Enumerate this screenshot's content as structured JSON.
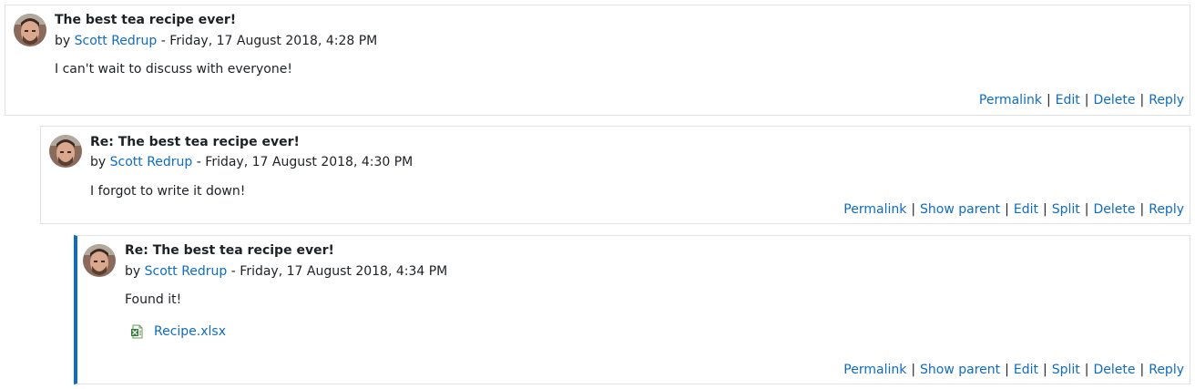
{
  "posts": [
    {
      "subject": "The best tea recipe ever!",
      "by_prefix": "by",
      "author": "Scott Redrup",
      "date": " - Friday, 17 August 2018, 4:28 PM",
      "content": "I can't wait to discuss with everyone!",
      "commands": [
        "Permalink",
        "Edit",
        "Delete",
        "Reply"
      ]
    },
    {
      "subject": "Re: The best tea recipe ever!",
      "by_prefix": "by",
      "author": "Scott Redrup",
      "date": " - Friday, 17 August 2018, 4:30 PM",
      "content": "I forgot to write it down!",
      "commands": [
        "Permalink",
        "Show parent",
        "Edit",
        "Split",
        "Delete",
        "Reply"
      ]
    },
    {
      "subject": "Re: The best tea recipe ever!",
      "by_prefix": "by",
      "author": "Scott Redrup",
      "date": " - Friday, 17 August 2018, 4:34 PM",
      "content": "Found it!",
      "attachment": {
        "name": "Recipe.xlsx",
        "icon": "excel-file-icon"
      },
      "commands": [
        "Permalink",
        "Show parent",
        "Edit",
        "Split",
        "Delete",
        "Reply"
      ]
    }
  ],
  "colors": {
    "link": "#0f6cbf",
    "highlight_border": "#0f6cbf",
    "border": "#dee2e6"
  }
}
